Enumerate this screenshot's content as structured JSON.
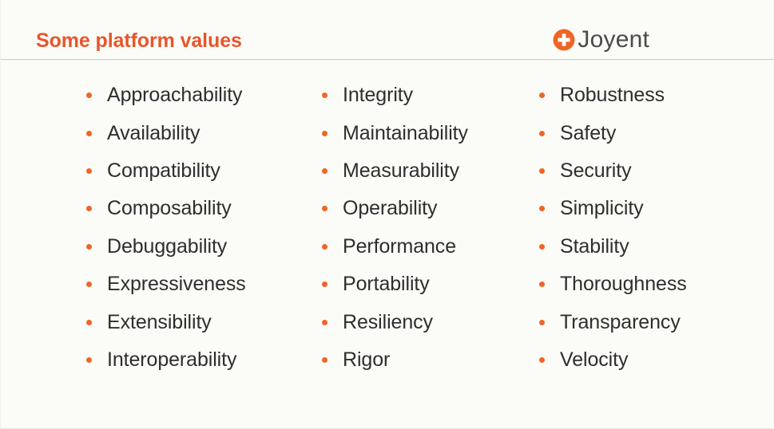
{
  "slide": {
    "title": "Some platform values",
    "background_color": "#fbfcf8",
    "accent_color": "#e8562a",
    "bullet_color": "#ef6526",
    "text_color": "#2e2e2e",
    "brand": {
      "wordmark": "Joyent",
      "mark_icon": "joyent-plus-circle-icon",
      "mark_color": "#ef6526",
      "wordmark_color": "#4a4a4a"
    },
    "columns": [
      {
        "name": "column-1",
        "items": [
          "Approachability",
          "Availability",
          "Compatibility",
          "Composability",
          "Debuggability",
          "Expressiveness",
          "Extensibility",
          "Interoperability"
        ]
      },
      {
        "name": "column-2",
        "items": [
          "Integrity",
          "Maintainability",
          "Measurability",
          "Operability",
          "Performance",
          "Portability",
          "Resiliency",
          "Rigor"
        ]
      },
      {
        "name": "column-3",
        "items": [
          "Robustness",
          "Safety",
          "Security",
          "Simplicity",
          "Stability",
          "Thoroughness",
          "Transparency",
          "Velocity"
        ]
      }
    ]
  }
}
